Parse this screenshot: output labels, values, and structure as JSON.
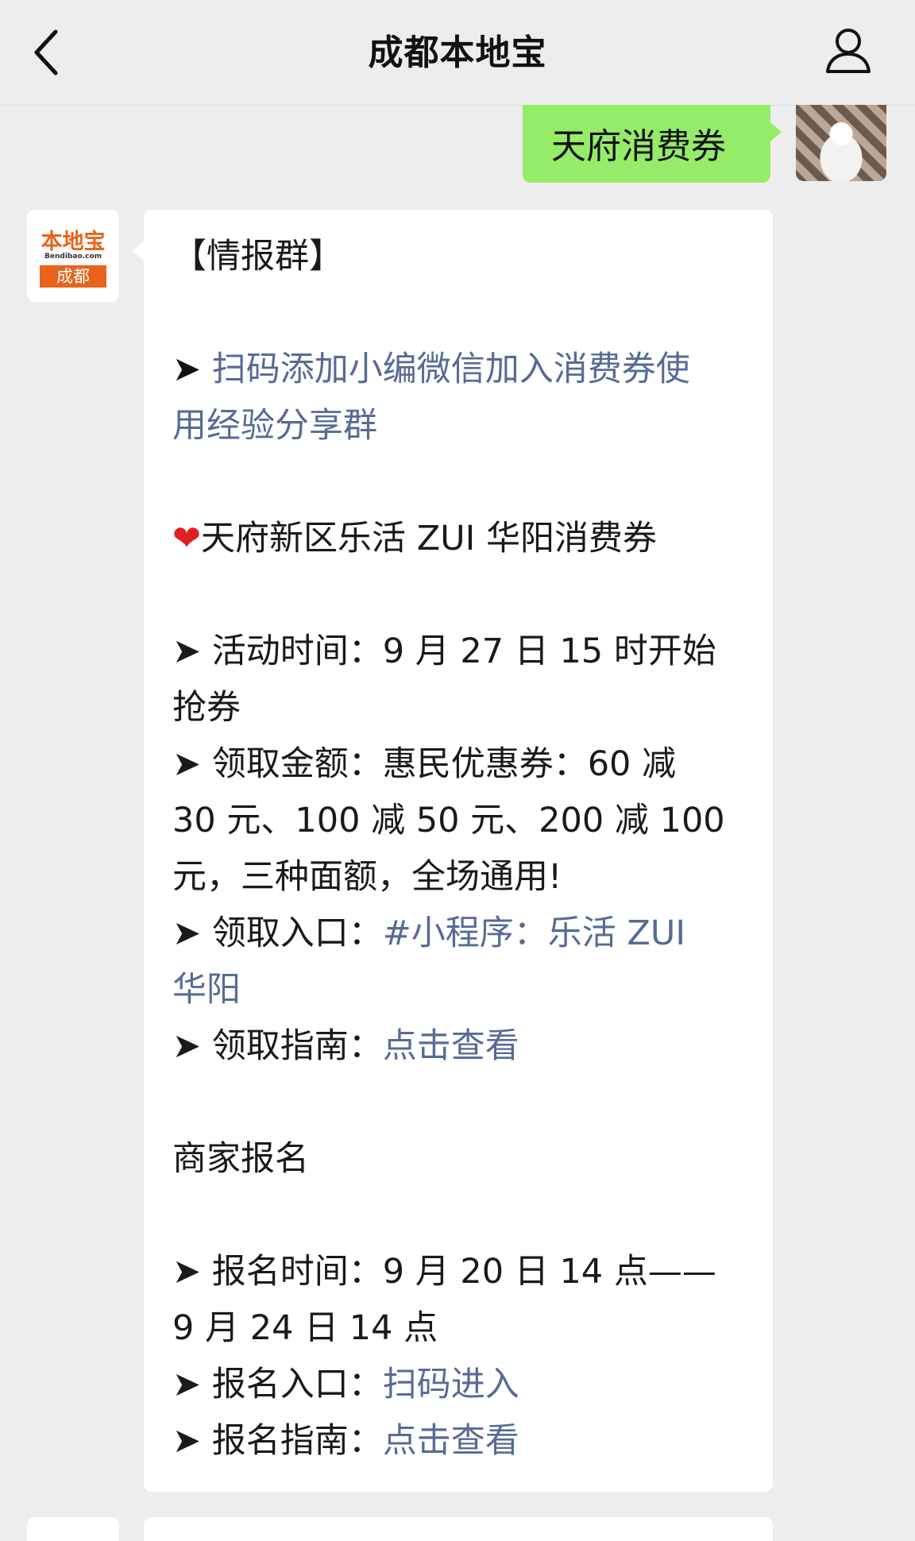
{
  "header": {
    "title": "成都本地宝",
    "back_icon": "chevron-left-icon",
    "profile_icon": "person-icon"
  },
  "outgoing": {
    "text": "天府消费券",
    "bubble_color": "#95ec69"
  },
  "incoming": {
    "avatar": {
      "logo_top": "本地宝",
      "logo_mid": "Bendibao.com",
      "logo_bottom": "成都"
    },
    "lines": {
      "l1": "【情报群】",
      "l2_arrow": "➤ ",
      "l2_link": "扫码添加小编微信加入消费券使",
      "l3_link": "用经验分享群",
      "l4_heart": "❤",
      "l4_text": "天府新区乐活 ZUI 华阳消费券",
      "l5": "➤ 活动时间：9 月 27 日 15 时开始",
      "l6": "抢券",
      "l7": "➤ 领取金额：惠民优惠券：60 减",
      "l8": "30 元、100 减 50 元、200 减 100",
      "l9": "元，三种面额，全场通用!",
      "l10_text": "➤ 领取入口：",
      "l10_link": "#小程序：乐活 ZUI",
      "l11_link": "华阳",
      "l12_text": "➤ 领取指南：",
      "l12_link": "点击查看",
      "l13": "商家报名",
      "l14": "➤ 报名时间：9 月 20 日 14 点——",
      "l15": "9 月 24 日 14 点",
      "l16_text": "➤ 报名入口：",
      "l16_link": "扫码进入",
      "l17_text": "➤ 报名指南：",
      "l17_link": "点击查看"
    },
    "link_color": "#576b95"
  }
}
